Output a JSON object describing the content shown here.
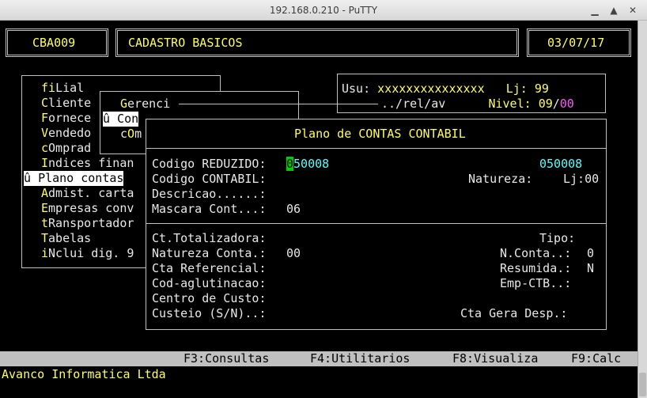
{
  "window": {
    "title": "192.168.0.210 - PuTTY",
    "minimize_glyph": "▁",
    "maximize_glyph": "▲",
    "close_glyph": "✕"
  },
  "header": {
    "program_code": "CBA009",
    "screen_title": "CADASTRO BASICOS",
    "date": "03/07/17"
  },
  "user_panel": {
    "usu_label": "Usu:",
    "usu_value": "xxxxxxxxxxxxxxx",
    "lj_label": "Lj:",
    "lj_value": "99",
    "path": "../rel/av",
    "nivel_label": "Nivel:",
    "nivel_a": "09",
    "nivel_sep": "/",
    "nivel_b": "00"
  },
  "main_menu": [
    {
      "hot": "fi",
      "rest": "Lial"
    },
    {
      "hot": "C",
      "rest": "liente"
    },
    {
      "hot": "F",
      "rest": "ornece"
    },
    {
      "hot": "V",
      "rest": "endedo"
    },
    {
      "hot": "c",
      "rest": "Omprad"
    },
    {
      "hot": "I",
      "rest": "ndices finan"
    },
    {
      "hot": "û ",
      "rest": "Plano contas"
    },
    {
      "hot": "A",
      "rest": "dmist. carta"
    },
    {
      "hot": "E",
      "rest": "mpresas conv"
    },
    {
      "hot": "t",
      "rest": "Ransportador"
    },
    {
      "hot": "T",
      "rest": "abelas"
    },
    {
      "hot": "i",
      "rest": "Nclui dig. 9"
    }
  ],
  "submenu": {
    "title_hot": "G",
    "title_rest": "erenci",
    "item1": "û Con",
    "item2_pre": "c",
    "item2_hot": "O",
    "item2_post": "m"
  },
  "dialog": {
    "title": "Plano de CONTAS CONTABIL",
    "cod_reduzido_label": "Codigo REDUZIDO:",
    "cod_reduzido_cursor": "0",
    "cod_reduzido_value": "50008",
    "cod_reduzido_right": "050008",
    "cod_contabil_label": "Codigo CONTABIL:",
    "natureza_label": "Natureza:",
    "lj_label": "Lj:",
    "lj_value": "00",
    "descricao_label": "Descricao......:",
    "mascara_label": "Mascara Cont...:",
    "mascara_value": "06",
    "ct_totalizadora_label": "Ct.Totalizadora:",
    "tipo_label": "Tipo:",
    "natureza_conta_label": "Natureza Conta.:",
    "natureza_conta_value": "00",
    "n_conta_label": "N.Conta..:",
    "n_conta_value": "0",
    "cta_referencial_label": "Cta Referencial:",
    "resumida_label": "Resumida.:",
    "resumida_value": "N",
    "cod_aglutinacao_label": "Cod-aglutinacao:",
    "emp_ctb_label": "Emp-CTB..:",
    "centro_custo_label": "Centro de Custo:",
    "custeio_label": "Custeio (S/N)..:",
    "cta_gera_desp_label": "Cta Gera Desp.:"
  },
  "function_keys": [
    "F3:Consultas",
    "F4:Utilitarios",
    "F8:Visualiza",
    "F9:Calc"
  ],
  "status_line": "Avanco Informatica Ltda",
  "colors": {
    "terminal_bg": "#000000",
    "text_gray": "#c0c0c0",
    "text_yellow": "#ffff55",
    "text_cyan": "#55ffff",
    "text_magenta": "#ff55ff",
    "cursor_green": "#00cc00",
    "fkey_bar_bg": "#c0c0c0"
  }
}
